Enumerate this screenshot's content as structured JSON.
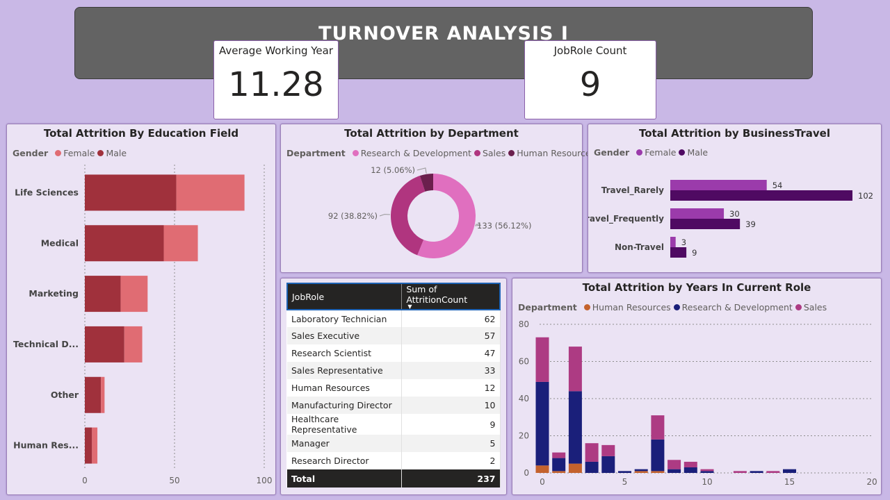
{
  "banner": {
    "title": "TURNOVER ANALYSIS I"
  },
  "kpis": {
    "avg_working_year": {
      "label": "Average Working Year",
      "value": "11.28"
    },
    "jobrole_count": {
      "label": "JobRole Count",
      "value": "9"
    }
  },
  "colors": {
    "female_edu": "#e06c73",
    "male_edu": "#a0313c",
    "rd": "#e06fbf",
    "sales": "#b0357f",
    "hr": "#6b1f4d",
    "bt_female": "#9b3bab",
    "bt_male": "#4f0a62",
    "yr_hr": "#c4622d",
    "yr_rd": "#1a1f7a",
    "yr_sales": "#ad3b83"
  },
  "education_panel": {
    "title": "Total Attrition By Education Field",
    "legend_title": "Gender",
    "legend": [
      {
        "label": "Female",
        "color": "#e06c73"
      },
      {
        "label": "Male",
        "color": "#a0313c"
      }
    ]
  },
  "department_panel": {
    "title": "Total Attrition by Department",
    "legend_title": "Department",
    "legend": [
      {
        "label": "Research & Development",
        "color": "#e06fbf"
      },
      {
        "label": "Sales",
        "color": "#b0357f"
      },
      {
        "label": "Human Resources",
        "color": "#6b1f4d"
      }
    ]
  },
  "travel_panel": {
    "title": "Total Attrition by BusinessTravel",
    "legend_title": "Gender",
    "legend": [
      {
        "label": "Female",
        "color": "#9b3bab"
      },
      {
        "label": "Male",
        "color": "#4f0a62"
      }
    ]
  },
  "years_panel": {
    "title": "Total Attrition by Years In Current Role",
    "legend_title": "Department",
    "legend": [
      {
        "label": "Human Resources",
        "color": "#c4622d"
      },
      {
        "label": "Research & Development",
        "color": "#1a1f7a"
      },
      {
        "label": "Sales",
        "color": "#ad3b83"
      }
    ]
  },
  "table": {
    "headers": [
      "JobRole",
      "Sum of AttritionCount"
    ],
    "rows": [
      {
        "role": "Laboratory Technician",
        "count": "62"
      },
      {
        "role": "Sales Executive",
        "count": "57"
      },
      {
        "role": "Research Scientist",
        "count": "47"
      },
      {
        "role": "Sales Representative",
        "count": "33"
      },
      {
        "role": "Human Resources",
        "count": "12"
      },
      {
        "role": "Manufacturing Director",
        "count": "10"
      },
      {
        "role": "Healthcare Representative",
        "count": "9"
      },
      {
        "role": "Manager",
        "count": "5"
      },
      {
        "role": "Research Director",
        "count": "2"
      }
    ],
    "total": {
      "label": "Total",
      "value": "237"
    }
  },
  "chart_data": [
    {
      "type": "bar",
      "orientation": "horizontal",
      "stacked": true,
      "categories": [
        "Life Sciences",
        "Medical",
        "Marketing",
        "Technical D...",
        "Other",
        "Human Res..."
      ],
      "series": [
        {
          "name": "Male",
          "values": [
            51,
            44,
            20,
            22,
            9,
            4
          ]
        },
        {
          "name": "Female",
          "values": [
            38,
            19,
            15,
            10,
            2,
            3
          ]
        }
      ],
      "xlim": [
        0,
        100
      ],
      "xticks": [
        "0",
        "50",
        "100"
      ],
      "grid": true
    },
    {
      "type": "pie",
      "donut": true,
      "labels": [
        "Research & Development",
        "Sales",
        "Human Resources"
      ],
      "values": [
        133,
        92,
        12
      ],
      "data_labels": [
        "133 (56.12%)",
        "92 (38.82%)",
        "12 (5.06%)"
      ]
    },
    {
      "type": "bar",
      "orientation": "horizontal",
      "categories": [
        "Travel_Rarely",
        "Travel_Frequently",
        "Non-Travel"
      ],
      "series": [
        {
          "name": "Female",
          "values": [
            54,
            30,
            3
          ]
        },
        {
          "name": "Male",
          "values": [
            102,
            39,
            9
          ]
        }
      ],
      "data_labels": true
    },
    {
      "type": "bar",
      "stacked": true,
      "x": [
        0,
        1,
        2,
        3,
        4,
        5,
        6,
        7,
        8,
        9,
        10,
        11,
        12,
        13,
        14,
        15
      ],
      "series": [
        {
          "name": "Human Resources",
          "values": [
            4,
            1,
            5,
            0,
            0,
            0,
            1,
            1,
            0,
            0,
            0,
            0,
            0,
            0,
            0,
            0
          ]
        },
        {
          "name": "Research & Development",
          "values": [
            45,
            7,
            39,
            6,
            9,
            1,
            1,
            17,
            2,
            3,
            1,
            0,
            0,
            1,
            0,
            2
          ]
        },
        {
          "name": "Sales",
          "values": [
            24,
            3,
            24,
            10,
            6,
            0,
            0,
            13,
            5,
            3,
            1,
            0,
            1,
            0,
            1,
            0
          ]
        }
      ],
      "xlim": [
        0,
        20
      ],
      "ylim": [
        0,
        80
      ],
      "xticks": [
        "0",
        "5",
        "10",
        "15",
        "20"
      ],
      "yticks": [
        "0",
        "20",
        "40",
        "60",
        "80"
      ],
      "grid": true
    }
  ]
}
